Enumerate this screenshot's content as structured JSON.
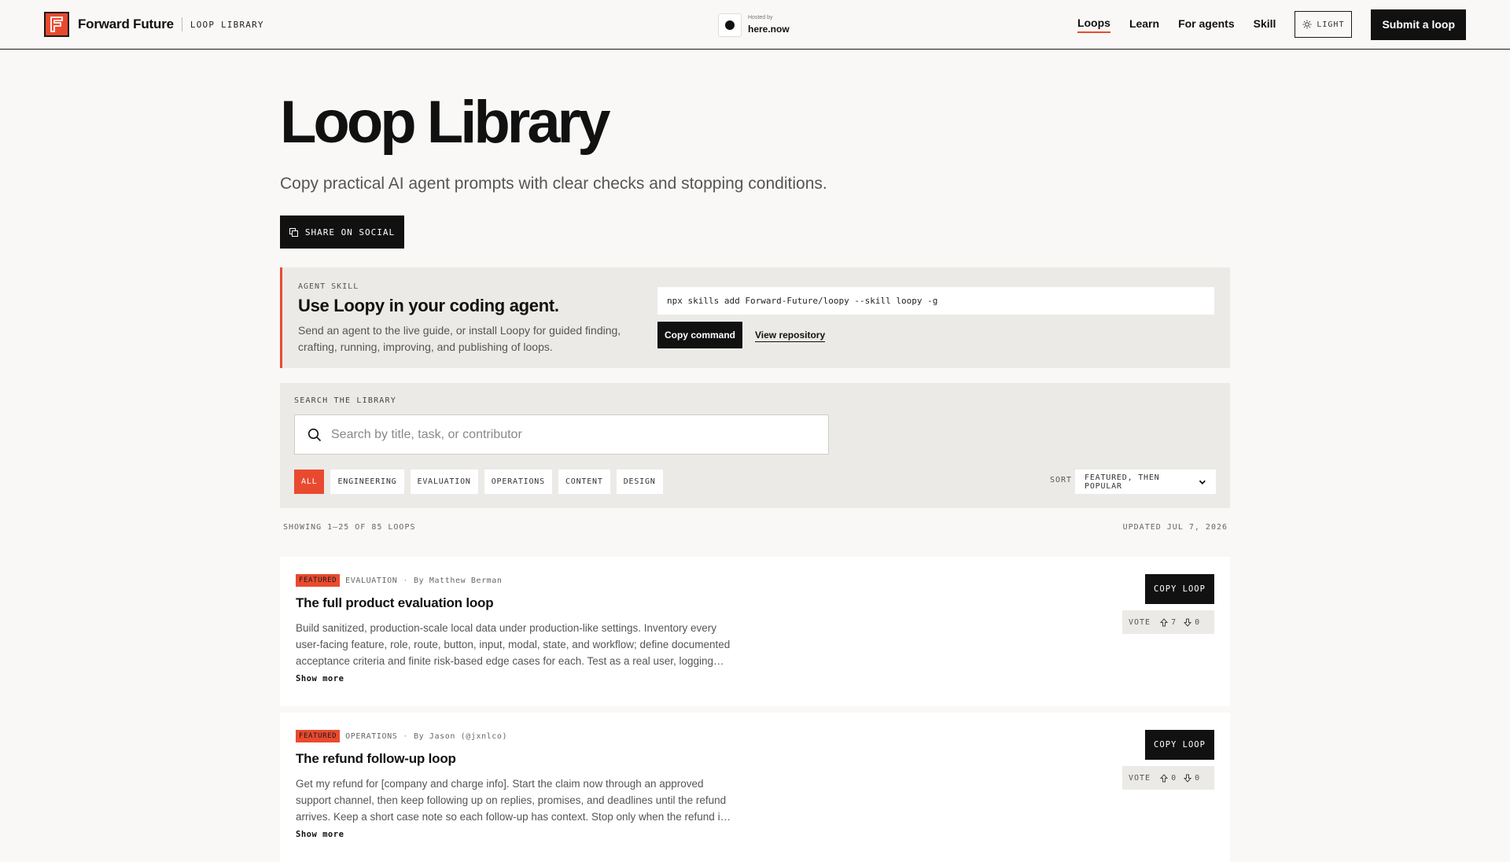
{
  "header": {
    "brand_name": "Forward Future",
    "brand_sub": "LOOP LIBRARY",
    "hosted_by": "Hosted by",
    "hosted_name": "here.now",
    "nav": [
      {
        "label": "Loops",
        "active": true
      },
      {
        "label": "Learn",
        "active": false
      },
      {
        "label": "For agents",
        "active": false
      },
      {
        "label": "Skill",
        "active": false
      }
    ],
    "theme_label": "LIGHT",
    "submit_label": "Submit a loop"
  },
  "hero": {
    "title": "Loop Library",
    "subtitle": "Copy practical AI agent prompts with clear checks and stopping conditions.",
    "share_label": "SHARE ON SOCIAL"
  },
  "skill": {
    "eyebrow": "AGENT SKILL",
    "title": "Use Loopy in your coding agent.",
    "description": "Send an agent to the live guide, or install Loopy for guided finding, crafting, running, improving, and publishing of loops.",
    "command": "npx skills add Forward-Future/loopy --skill loopy -g",
    "copy_label": "Copy command",
    "repo_label": "View repository"
  },
  "search": {
    "eyebrow": "SEARCH THE LIBRARY",
    "placeholder": "Search by title, task, or contributor",
    "value": "",
    "chips": [
      {
        "label": "ALL",
        "active": true
      },
      {
        "label": "ENGINEERING",
        "active": false
      },
      {
        "label": "EVALUATION",
        "active": false
      },
      {
        "label": "OPERATIONS",
        "active": false
      },
      {
        "label": "CONTENT",
        "active": false
      },
      {
        "label": "DESIGN",
        "active": false
      }
    ],
    "sort_label": "SORT",
    "sort_value": "FEATURED, THEN POPULAR"
  },
  "results": {
    "showing": "SHOWING 1–25 OF 85 LOOPS",
    "updated": "UPDATED JUL 7, 2026"
  },
  "loops": [
    {
      "badge": "FEATURED",
      "category": "EVALUATION",
      "author": "By Matthew Berman",
      "title": "The full product evaluation loop",
      "description": "Build sanitized, production-scale local data under production-like settings. Inventory every user-facing feature, role, route, button, input, modal, state, and workflow; define documented acceptance criteria and finite risk-based edge cases for each. Test as a real user, logging…",
      "show_more": "Show more",
      "copy_label": "COPY LOOP",
      "vote_label": "VOTE",
      "upvotes": "7",
      "downvotes": "0"
    },
    {
      "badge": "FEATURED",
      "category": "OPERATIONS",
      "author": "By Jason (@jxnlco)",
      "title": "The refund follow-up loop",
      "description": "Get my refund for [company and charge info]. Start the claim now through an approved support channel, then keep following up on replies, promises, and deadlines until the refund arrives. Keep a short case note so each follow-up has context. Stop only when the refund i…",
      "show_more": "Show more",
      "copy_label": "COPY LOOP",
      "vote_label": "VOTE",
      "upvotes": "0",
      "downvotes": "0"
    }
  ],
  "colors": {
    "accent": "#e94a2f",
    "ink": "#111111",
    "page_bg": "#f9f8f6",
    "panel_bg": "#eceae7"
  },
  "icons": [
    "forward-future-logo",
    "circle-dot-icon",
    "sun-icon",
    "copy-icon",
    "search-icon",
    "chevron-down-icon",
    "arrow-up-icon",
    "arrow-down-icon"
  ]
}
